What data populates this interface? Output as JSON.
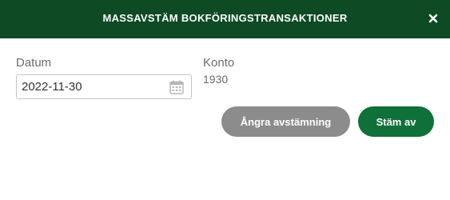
{
  "dialog": {
    "title": "MASSAVSTÄM BOKFÖRINGSTRANSAKTIONER",
    "close_icon": "close-icon"
  },
  "form": {
    "date_label": "Datum",
    "date_value": "2022-11-30",
    "calendar_icon": "calendar-icon",
    "account_label": "Konto",
    "account_value": "1930"
  },
  "actions": {
    "undo_label": "Ångra avstämning",
    "reconcile_label": "Stäm av"
  },
  "colors": {
    "header_bg": "#0e4a24",
    "primary_button": "#10703a",
    "secondary_button": "#8c8c8c"
  }
}
